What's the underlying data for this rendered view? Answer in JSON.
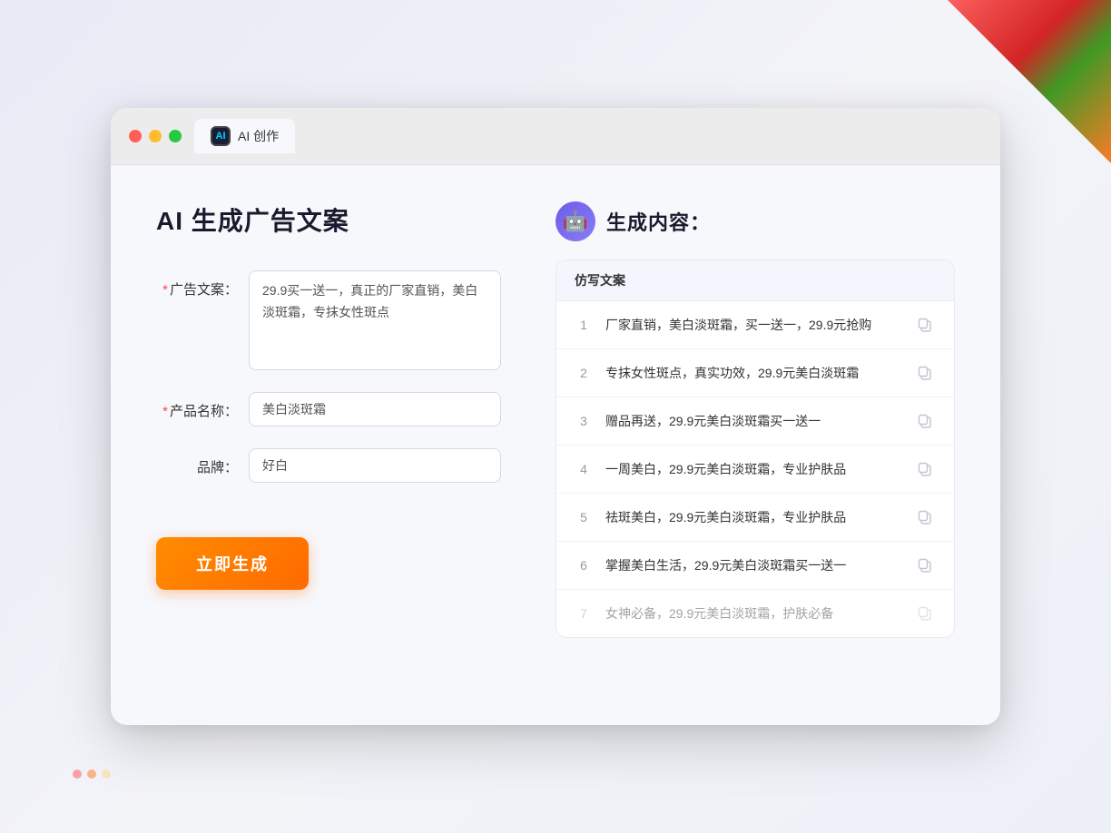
{
  "browser": {
    "tab_label": "AI 创作",
    "tab_icon_text": "AI"
  },
  "page": {
    "title": "AI 生成广告文案",
    "result_section_title": "生成内容："
  },
  "form": {
    "ad_copy_label": "广告文案：",
    "ad_copy_required": "*",
    "ad_copy_value": "29.9买一送一，真正的厂家直销，美白淡斑霜，专抹女性斑点",
    "product_name_label": "产品名称：",
    "product_name_required": "*",
    "product_name_value": "美白淡斑霜",
    "brand_label": "品牌：",
    "brand_value": "好白",
    "generate_btn_label": "立即生成"
  },
  "results": {
    "table_header": "仿写文案",
    "items": [
      {
        "num": 1,
        "text": "厂家直销，美白淡斑霜，买一送一，29.9元抢购",
        "faded": false
      },
      {
        "num": 2,
        "text": "专抹女性斑点，真实功效，29.9元美白淡斑霜",
        "faded": false
      },
      {
        "num": 3,
        "text": "赠品再送，29.9元美白淡斑霜买一送一",
        "faded": false
      },
      {
        "num": 4,
        "text": "一周美白，29.9元美白淡斑霜，专业护肤品",
        "faded": false
      },
      {
        "num": 5,
        "text": "祛斑美白，29.9元美白淡斑霜，专业护肤品",
        "faded": false
      },
      {
        "num": 6,
        "text": "掌握美白生活，29.9元美白淡斑霜买一送一",
        "faded": false
      },
      {
        "num": 7,
        "text": "女神必备，29.9元美白淡斑霜，护肤必备",
        "faded": true
      }
    ]
  }
}
